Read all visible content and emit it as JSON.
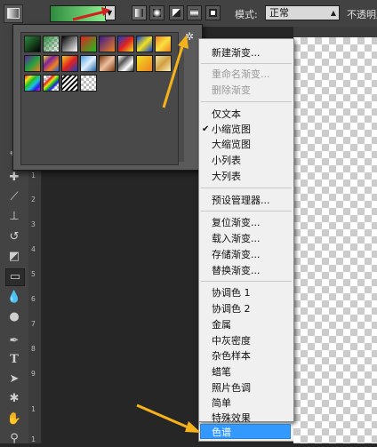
{
  "options_bar": {
    "mode_label": "模式:",
    "mode_value": "正常",
    "opacity_label": "不透明度",
    "gradient_preview_colors": [
      "#2e8b3e",
      "#8cf08f"
    ],
    "gradient_types": [
      "linear",
      "radial",
      "angle",
      "reflected",
      "diamond"
    ]
  },
  "toolbar": {
    "tools": [
      "eyedropper-icon",
      "healing-brush-icon",
      "brush-icon",
      "clone-stamp-icon",
      "history-brush-icon",
      "eraser-icon",
      "gradient-icon",
      "blur-icon",
      "dodge-icon",
      "pen-icon",
      "type-icon",
      "path-selection-icon",
      "shape-icon",
      "hand-icon",
      "zoom-icon"
    ]
  },
  "ruler": {
    "marks": [
      "0",
      "1",
      "2",
      "3",
      "4",
      "5",
      "6",
      "7",
      "8",
      "9",
      "1",
      "1"
    ]
  },
  "gradient_picker": {
    "swatches": [
      "gradient-fg-bg",
      "gradient-fg-transparent",
      "gradient-black-white",
      "gradient-red-green",
      "gradient-violet-orange",
      "gradient-blue-red-yellow",
      "gradient-blue-yellow-blue",
      "gradient-orange-yellow-orange",
      "gradient-violet-green-orange",
      "gradient-yellow-violet-orange-blue",
      "gradient-copper",
      "gradient-chrome",
      "gradient-spectrum",
      "gradient-transparent-rainbow",
      "gradient-transparent-stripes",
      "gradient-neutral-density"
    ]
  },
  "context_menu": {
    "items": [
      {
        "label": "新建渐变...",
        "state": "normal"
      },
      {
        "label": "重命名渐变...",
        "state": "disabled"
      },
      {
        "label": "删除渐变",
        "state": "disabled"
      },
      {
        "label": "仅文本",
        "state": "normal"
      },
      {
        "label": "小缩览图",
        "state": "checked"
      },
      {
        "label": "大缩览图",
        "state": "normal"
      },
      {
        "label": "小列表",
        "state": "normal"
      },
      {
        "label": "大列表",
        "state": "normal"
      },
      {
        "label": "预设管理器...",
        "state": "normal"
      },
      {
        "label": "复位渐变...",
        "state": "normal"
      },
      {
        "label": "载入渐变...",
        "state": "normal"
      },
      {
        "label": "存储渐变...",
        "state": "normal"
      },
      {
        "label": "替换渐变...",
        "state": "normal"
      },
      {
        "label": "协调色 1",
        "state": "normal"
      },
      {
        "label": "协调色 2",
        "state": "normal"
      },
      {
        "label": "金属",
        "state": "normal"
      },
      {
        "label": "中灰密度",
        "state": "normal"
      },
      {
        "label": "杂色样本",
        "state": "normal"
      },
      {
        "label": "蜡笔",
        "state": "normal"
      },
      {
        "label": "照片色调",
        "state": "normal"
      },
      {
        "label": "简单",
        "state": "normal"
      },
      {
        "label": "特殊效果",
        "state": "normal"
      },
      {
        "label": "色谱",
        "state": "highlighted"
      }
    ],
    "check_mark": "✔"
  },
  "colors": {
    "menu_highlight": "#3399ff",
    "annotation_arrow": "#f5b21a",
    "annotation_red": "#d32020"
  }
}
